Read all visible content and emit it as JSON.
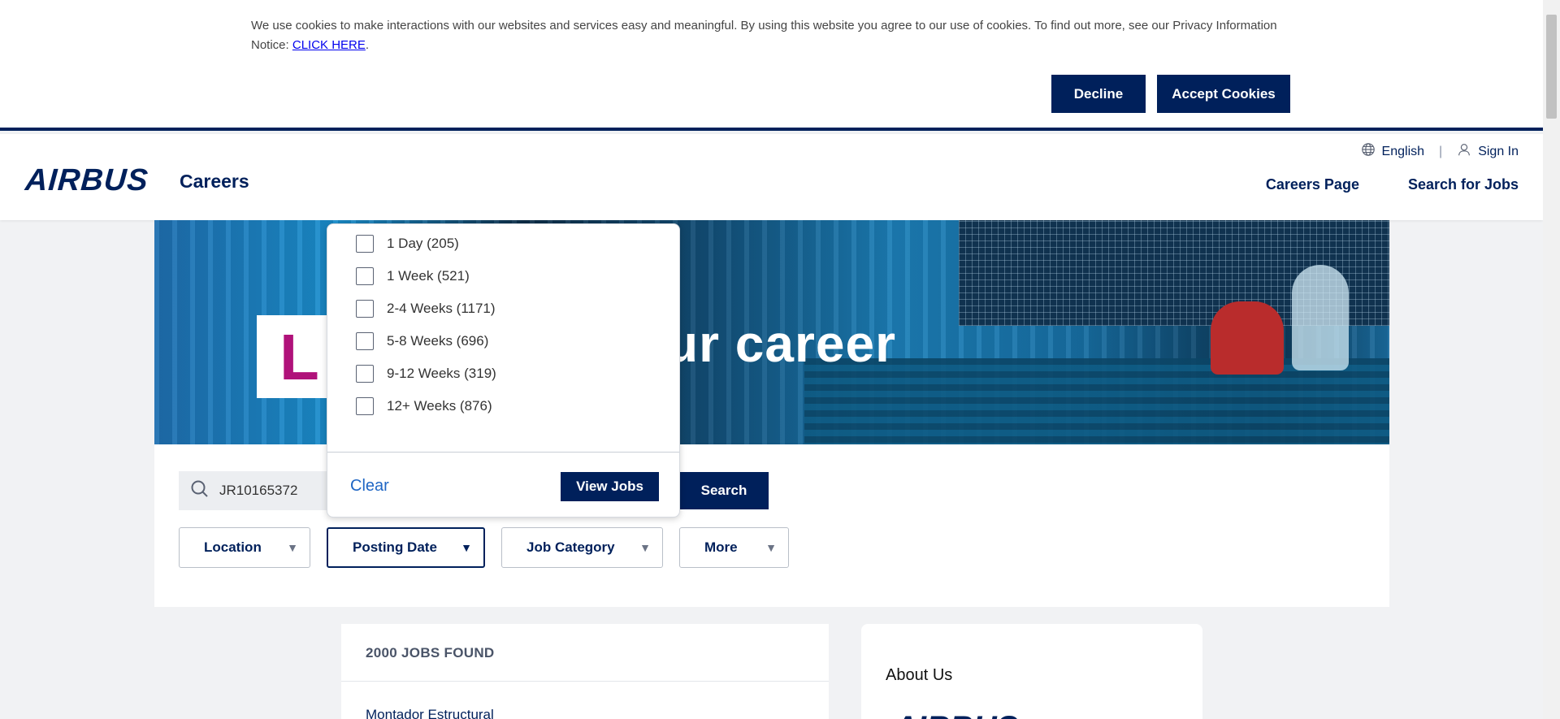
{
  "cookie_banner": {
    "text": "We use cookies to make interactions with our websites and services easy and meaningful. By using this website you agree to our use of cookies. To find out more, see our Privacy Information Notice: ",
    "link_text": "CLICK HERE",
    "after_link": ".",
    "decline_label": "Decline",
    "accept_label": "Accept Cookies"
  },
  "header": {
    "logo_text": "AIRBUS",
    "subtitle": "Careers",
    "language": "English",
    "sign_in": "Sign In",
    "nav": [
      "Careers Page",
      "Search for Jobs"
    ]
  },
  "hero": {
    "letter": "L",
    "text": "ur career"
  },
  "search": {
    "value": "JR10165372",
    "button_label": "Search"
  },
  "filters": {
    "location": "Location",
    "posting_date": "Posting Date",
    "job_category": "Job Category",
    "more": "More"
  },
  "posting_date_dropdown": {
    "options": [
      "1 Day (205)",
      "1 Week (521)",
      "2-4 Weeks (1171)",
      "5-8 Weeks (696)",
      "9-12 Weeks (319)",
      "12+ Weeks (876)"
    ],
    "clear_label": "Clear",
    "view_jobs_label": "View Jobs"
  },
  "results": {
    "count": "2000 JOBS FOUND",
    "first_job": "Montador Estructural"
  },
  "about": {
    "title": "About Us",
    "logo_text": "AIRBUS"
  },
  "colors": {
    "navy": "#00205b",
    "link_blue": "#1f66c4",
    "page_bg": "#f1f2f4"
  }
}
